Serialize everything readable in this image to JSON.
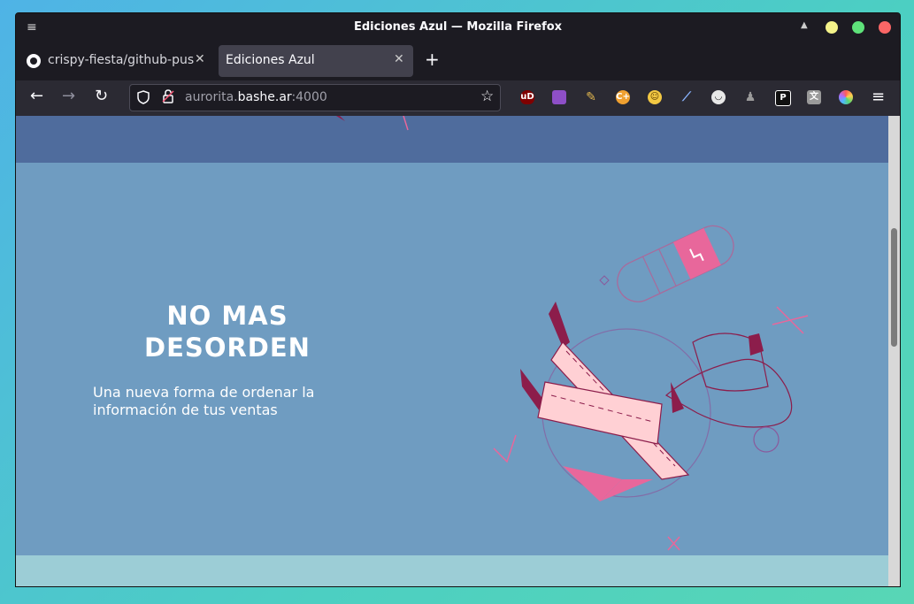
{
  "window": {
    "title": "Ediciones Azul — Mozilla Firefox"
  },
  "tabs": [
    {
      "label": "crispy-fiesta/github-push",
      "icon": "github-icon",
      "active": false
    },
    {
      "label": "Ediciones Azul",
      "active": true
    }
  ],
  "navbar": {
    "url_prefix": "aurorita.",
    "url_host": "bashe.ar",
    "url_port": ":4000"
  },
  "extensions": [
    "ublock-icon",
    "cube-icon",
    "broom-icon",
    "cplus-icon",
    "emoji-icon",
    "dropper-icon",
    "fox-mask-icon",
    "spy-icon",
    "p-icon",
    "translate-icon",
    "color-ring-icon"
  ],
  "hero": {
    "title": "NO MAS DESORDEN",
    "subtitle": "Una nueva forma de ordenar la información de tus ventas"
  },
  "colors": {
    "band_top": "#4f6c9d",
    "hero_bg": "#6f9cc1",
    "band_bottom": "#9ccdd6",
    "accent_pink": "#e8679b",
    "accent_maroon": "#8c1d4b"
  }
}
